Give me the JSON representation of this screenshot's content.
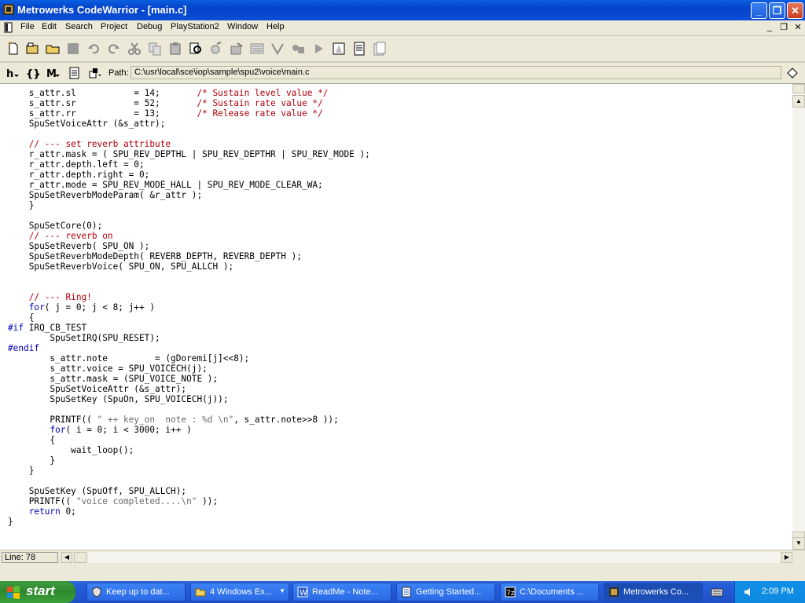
{
  "window": {
    "title": "Metrowerks CodeWarrior - [main.c]",
    "minimize_label": "_",
    "maximize_label": "❐",
    "close_label": "✕"
  },
  "menu": {
    "items": [
      "File",
      "Edit",
      "Search",
      "Project",
      "Debug",
      "PlayStation2",
      "Window",
      "Help"
    ],
    "mdi_min": "_",
    "mdi_restore": "❐",
    "mdi_close": "✕"
  },
  "pathbar": {
    "label": "Path:",
    "value": "C:\\usr\\local\\sce\\iop\\sample\\spu2\\voice\\main.c"
  },
  "code_lines": [
    [
      {
        "t": "    s_attr.sl           = 14;       "
      },
      {
        "c": "cm",
        "t": "/* Sustain level value */"
      }
    ],
    [
      {
        "t": "    s_attr.sr           = 52;       "
      },
      {
        "c": "cm",
        "t": "/* Sustain rate value */"
      }
    ],
    [
      {
        "t": "    s_attr.rr           = 13;       "
      },
      {
        "c": "cm",
        "t": "/* Release rate value */"
      }
    ],
    [
      {
        "t": "    SpuSetVoiceAttr (&s_attr);"
      }
    ],
    [
      {
        "t": ""
      }
    ],
    [
      {
        "t": "    "
      },
      {
        "c": "cm",
        "t": "// --- set reverb attribute"
      }
    ],
    [
      {
        "t": "    r_attr.mask = ( SPU_REV_DEPTHL | SPU_REV_DEPTHR | SPU_REV_MODE );"
      }
    ],
    [
      {
        "t": "    r_attr.depth.left = 0;"
      }
    ],
    [
      {
        "t": "    r_attr.depth.right = 0;"
      }
    ],
    [
      {
        "t": "    r_attr.mode = SPU_REV_MODE_HALL | SPU_REV_MODE_CLEAR_WA;"
      }
    ],
    [
      {
        "t": "    SpuSetReverbModeParam( &r_attr );"
      }
    ],
    [
      {
        "t": "    }"
      }
    ],
    [
      {
        "t": ""
      }
    ],
    [
      {
        "t": "    SpuSetCore(0);"
      }
    ],
    [
      {
        "t": "    "
      },
      {
        "c": "cm",
        "t": "// --- reverb on"
      }
    ],
    [
      {
        "t": "    SpuSetReverb( SPU_ON );"
      }
    ],
    [
      {
        "t": "    SpuSetReverbModeDepth( REVERB_DEPTH, REVERB_DEPTH );"
      }
    ],
    [
      {
        "t": "    SpuSetReverbVoice( SPU_ON, SPU_ALLCH );"
      }
    ],
    [
      {
        "t": ""
      }
    ],
    [
      {
        "t": ""
      }
    ],
    [
      {
        "t": "    "
      },
      {
        "c": "cm",
        "t": "// --- Ring!"
      }
    ],
    [
      {
        "t": "    "
      },
      {
        "c": "kw",
        "t": "for"
      },
      {
        "t": "( j = 0; j < 8; j++ )"
      }
    ],
    [
      {
        "t": "    {"
      }
    ],
    [
      {
        "c": "kw",
        "t": "#if"
      },
      {
        "t": " IRQ_CB_TEST"
      }
    ],
    [
      {
        "t": "        SpuSetIRQ(SPU_RESET);"
      }
    ],
    [
      {
        "c": "kw",
        "t": "#endif"
      }
    ],
    [
      {
        "t": "        s_attr.note         = (gDoremi[j]<<8);"
      }
    ],
    [
      {
        "t": "        s_attr.voice = SPU_VOICECH(j);"
      }
    ],
    [
      {
        "t": "        s_attr.mask = (SPU_VOICE_NOTE );"
      }
    ],
    [
      {
        "t": "        SpuSetVoiceAttr (&s_attr);"
      }
    ],
    [
      {
        "t": "        SpuSetKey (SpuOn, SPU_VOICECH(j));"
      }
    ],
    [
      {
        "t": ""
      }
    ],
    [
      {
        "t": "        PRINTF(( "
      },
      {
        "c": "st",
        "t": "\" ++ key_on  note : %d \\n\""
      },
      {
        "t": ", s_attr.note>>8 ));"
      }
    ],
    [
      {
        "t": "        "
      },
      {
        "c": "kw",
        "t": "for"
      },
      {
        "t": "( i = 0; i < 3000; i++ )"
      }
    ],
    [
      {
        "t": "        {"
      }
    ],
    [
      {
        "t": "            wait_loop();"
      }
    ],
    [
      {
        "t": "        }"
      }
    ],
    [
      {
        "t": "    }"
      }
    ],
    [
      {
        "t": ""
      }
    ],
    [
      {
        "t": "    SpuSetKey (SpuOff, SPU_ALLCH);"
      }
    ],
    [
      {
        "t": "    PRINTF(( "
      },
      {
        "c": "st",
        "t": "\"voice completed....\\n\""
      },
      {
        "t": " ));"
      }
    ],
    [
      {
        "t": "    "
      },
      {
        "c": "kw",
        "t": "return"
      },
      {
        "t": " 0;"
      }
    ],
    [
      {
        "t": "}"
      }
    ]
  ],
  "status": {
    "line": "Line: 78"
  },
  "taskbar": {
    "start_label": "start",
    "tasks": [
      {
        "label": "Keep up to dat...",
        "icon": "shield-icon"
      },
      {
        "label": "4 Windows Ex...",
        "icon": "folder-icon"
      },
      {
        "label": "ReadMe - Note...",
        "icon": "word-icon"
      },
      {
        "label": "Getting Started...",
        "icon": "document-icon"
      },
      {
        "label": "C:\\Documents ...",
        "icon": "7zip-icon"
      },
      {
        "label": "Metrowerks Co...",
        "icon": "codewarrior-icon"
      }
    ],
    "clock": "2:09 PM"
  },
  "colors": {
    "comment": "#b0000a",
    "keyword": "#0000b8",
    "string": "#6a6a6a",
    "titlebar": "#0543c8",
    "taskbar": "#245edb"
  }
}
